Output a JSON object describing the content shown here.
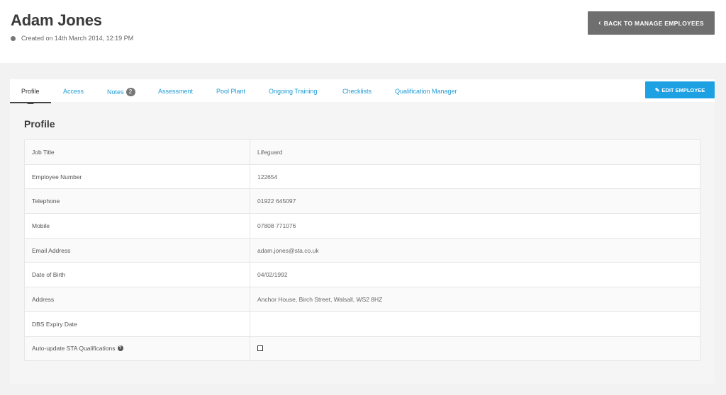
{
  "header": {
    "title": "Adam Jones",
    "created": "Created on 14th March 2014, 12:19 PM",
    "back_button": "BACK TO MANAGE EMPLOYEES"
  },
  "tabs": [
    {
      "label": "Profile",
      "active": true
    },
    {
      "label": "Access"
    },
    {
      "label": "Notes",
      "badge": "2"
    },
    {
      "label": "Assessment"
    },
    {
      "label": "Pool Plant"
    },
    {
      "label": "Ongoing Training"
    },
    {
      "label": "Checklists"
    },
    {
      "label": "Qualification Manager"
    }
  ],
  "edit_button": "EDIT EMPLOYEE",
  "profile": {
    "title": "Profile",
    "rows": [
      {
        "label": "Job Title",
        "value": "Lifeguard"
      },
      {
        "label": "Employee Number",
        "value": "122654"
      },
      {
        "label": "Telephone",
        "value": "01922 645097"
      },
      {
        "label": "Mobile",
        "value": "07808 771076"
      },
      {
        "label": "Email Address",
        "value": "adam.jones@sta.co.uk"
      },
      {
        "label": "Date of Birth",
        "value": "04/02/1992"
      },
      {
        "label": "Address",
        "value": "Anchor House, Birch Street, Walsall, WS2 8HZ"
      },
      {
        "label": "DBS Expiry Date",
        "value": ""
      },
      {
        "label": "Auto-update STA Qualifications",
        "value": "",
        "checkbox": false
      }
    ]
  },
  "colors": {
    "accent": "#1ea1e3",
    "link": "#1e9bd6",
    "back_button": "#6f6f6f"
  },
  "icons": {
    "back": "chevron-left-icon",
    "edit": "pencil-icon",
    "help": "question-circle-icon"
  }
}
